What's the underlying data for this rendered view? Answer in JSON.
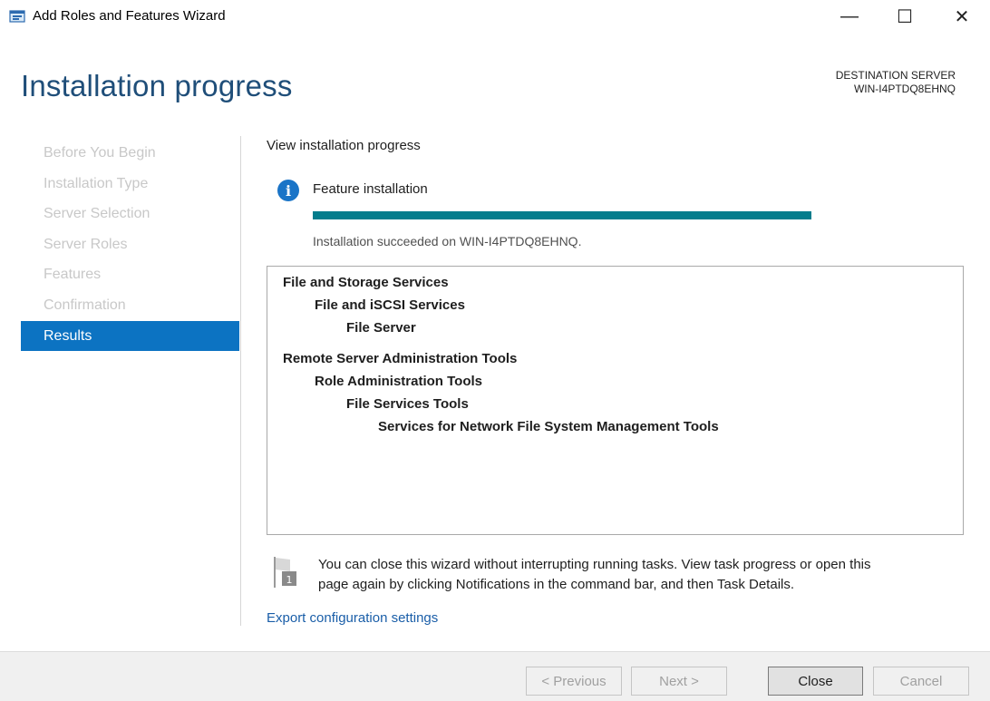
{
  "window": {
    "title": "Add Roles and Features Wizard",
    "minimize": "—",
    "maximize": "☐",
    "close": "✕"
  },
  "page_title": "Installation progress",
  "destination": {
    "label": "DESTINATION SERVER",
    "server": "WIN-I4PTDQ8EHNQ"
  },
  "nav": {
    "items": [
      {
        "label": "Before You Begin"
      },
      {
        "label": "Installation Type"
      },
      {
        "label": "Server Selection"
      },
      {
        "label": "Server Roles"
      },
      {
        "label": "Features"
      },
      {
        "label": "Confirmation"
      },
      {
        "label": "Results"
      }
    ],
    "active": "Results"
  },
  "main": {
    "heading": "View installation progress",
    "feature_label": "Feature installation",
    "progress_percent": 100,
    "status": "Installation succeeded on WIN-I4PTDQ8EHNQ.",
    "results": [
      "File and Storage Services",
      "File and iSCSI Services",
      "File Server",
      "Remote Server Administration Tools",
      "Role Administration Tools",
      "File Services Tools",
      "Services for Network File System Management Tools"
    ],
    "note_line1": "You can close this wizard without interrupting running tasks. View task progress or open this",
    "note_line2": "page again by clicking Notifications in the command bar, and then Task Details.",
    "flag_badge": "1",
    "export_link": "Export configuration settings"
  },
  "footer": {
    "previous": "< Previous",
    "next": "Next >",
    "close": "Close",
    "cancel": "Cancel"
  },
  "colors": {
    "accent": "#0c73c2",
    "progress": "#047d8c",
    "title": "#1f4e79",
    "link": "#1a5ea8"
  }
}
